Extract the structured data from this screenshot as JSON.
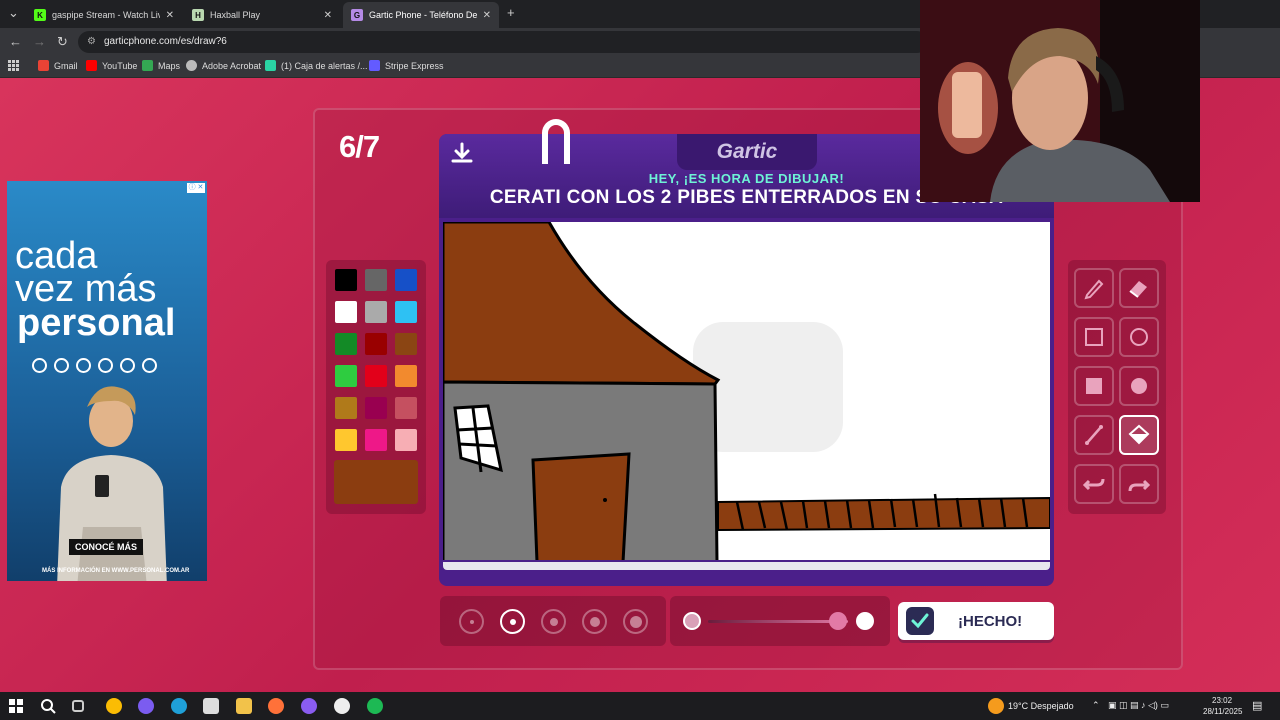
{
  "browser": {
    "tabs": [
      {
        "title": "gaspipe Stream - Watch Live o",
        "fav": "K",
        "fav_color": "#53fc18"
      },
      {
        "title": "Haxball Play",
        "fav": "H",
        "fav_color": "#b9d8b0"
      },
      {
        "title": "Gartic Phone - Teléfono Desco",
        "fav": "G",
        "fav_color": "#b58ae6"
      }
    ],
    "url": "garticphone.com/es/draw?6",
    "bookmarks": [
      "Gmail",
      "YouTube",
      "Maps",
      "Adobe Acrobat",
      "(1) Caja de alertas /...",
      "Stripe Express"
    ]
  },
  "game": {
    "round": "6/7",
    "logo": "Gartic",
    "subtitle": "HEY, ¡ES HORA DE DIBUJAR!",
    "prompt": "CERATI CON LOS 2 PIBES ENTERRADOS EN SU CASA",
    "done_label": "¡HECHO!",
    "current_color": "#8b3d10",
    "palette": [
      "#000000",
      "#666666",
      "#1650c8",
      "#ffffff",
      "#aaaaaa",
      "#2ec1f3",
      "#138a26",
      "#990000",
      "#8b4513",
      "#2ecc40",
      "#e2001a",
      "#f28a2e",
      "#b07a1a",
      "#990050",
      "#c55060",
      "#ffc72e",
      "#ee1888",
      "#f7aeb4"
    ],
    "tools": [
      "pen-icon",
      "eraser-icon",
      "rectangle-outline-icon",
      "circle-outline-icon",
      "rectangle-fill-icon",
      "circle-fill-icon",
      "line-icon",
      "fill-bucket-icon",
      "undo-icon",
      "redo-icon"
    ],
    "selected_tool": 7,
    "brush_sizes": [
      4,
      6,
      8,
      10,
      12
    ],
    "selected_brush": 1
  },
  "ad": {
    "line1": "cada",
    "line2": "vez más",
    "line3": "personal",
    "cta": "CONOCÉ MÁS",
    "footer": "MÁS INFORMACIÓN EN WWW.PERSONAL.COM.AR"
  },
  "taskbar": {
    "weather": "19°C  Despejado",
    "time": "23:02",
    "date": "28/11/2025"
  }
}
